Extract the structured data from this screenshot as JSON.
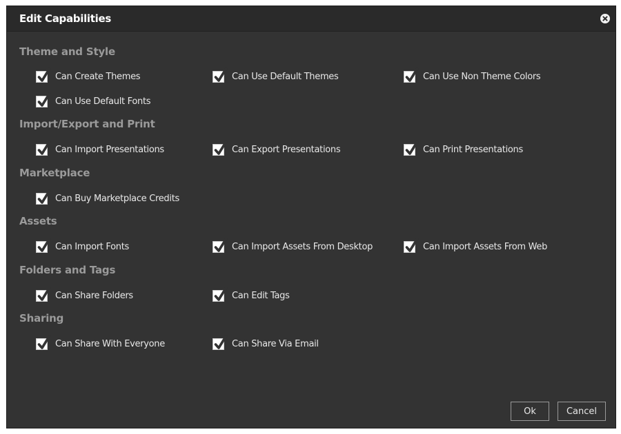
{
  "dialog": {
    "title": "Edit Capabilities",
    "ok_label": "Ok",
    "cancel_label": "Cancel"
  },
  "sections": [
    {
      "title": "Theme and Style",
      "items": [
        {
          "label": "Can Create Themes",
          "checked": true
        },
        {
          "label": "Can Use Default Themes",
          "checked": true
        },
        {
          "label": "Can Use Non Theme Colors",
          "checked": true
        },
        {
          "label": "Can Use Default Fonts",
          "checked": true
        }
      ]
    },
    {
      "title": "Import/Export and Print",
      "items": [
        {
          "label": "Can Import Presentations",
          "checked": true
        },
        {
          "label": "Can Export Presentations",
          "checked": true
        },
        {
          "label": "Can Print Presentations",
          "checked": true
        }
      ]
    },
    {
      "title": "Marketplace",
      "items": [
        {
          "label": "Can Buy Marketplace Credits",
          "checked": true
        }
      ]
    },
    {
      "title": "Assets",
      "items": [
        {
          "label": "Can Import Fonts",
          "checked": true
        },
        {
          "label": "Can Import Assets From Desktop",
          "checked": true
        },
        {
          "label": "Can Import Assets From Web",
          "checked": true
        }
      ]
    },
    {
      "title": "Folders and Tags",
      "items": [
        {
          "label": "Can Share Folders",
          "checked": true
        },
        {
          "label": "Can Edit Tags",
          "checked": true
        }
      ]
    },
    {
      "title": "Sharing",
      "items": [
        {
          "label": "Can Share With Everyone",
          "checked": true
        },
        {
          "label": "Can Share Via Email",
          "checked": true
        }
      ]
    }
  ]
}
